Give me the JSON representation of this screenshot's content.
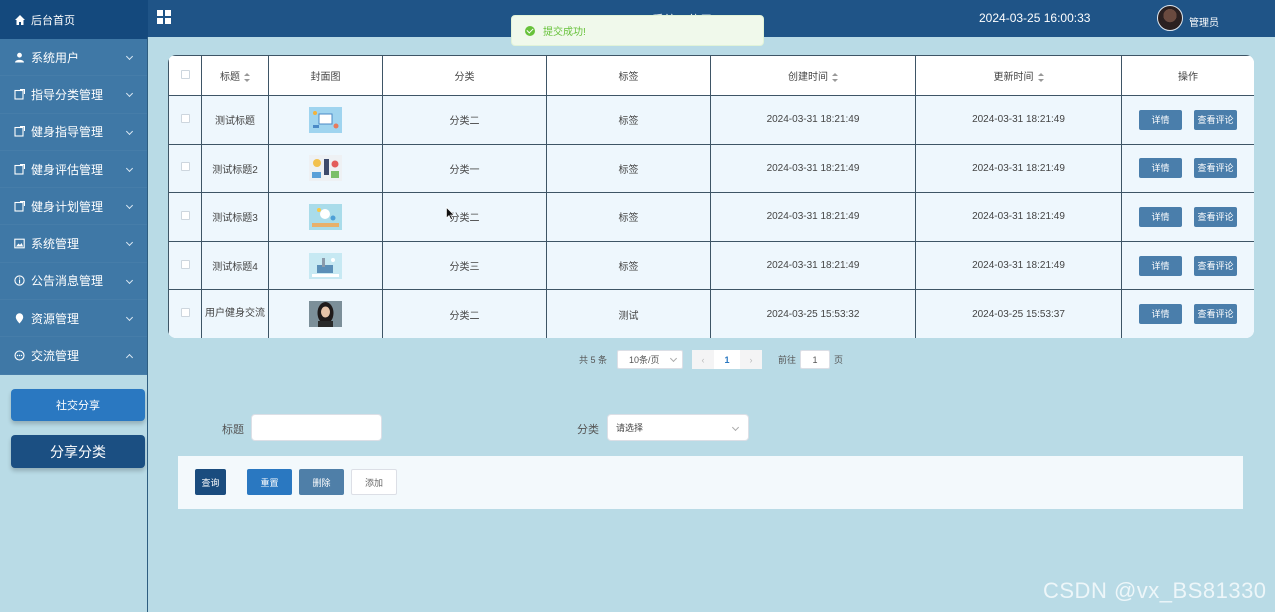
{
  "topbar": {
    "home_label": "后台首页",
    "system_title": "…系统…使用",
    "datetime": "2024-03-25 16:00:33",
    "admin_name": "管理员"
  },
  "toast": {
    "message": "提交成功!"
  },
  "sidebar": {
    "items": [
      {
        "label": "系统用户",
        "icon": "user-icon"
      },
      {
        "label": "指导分类管理",
        "icon": "doc-icon"
      },
      {
        "label": "健身指导管理",
        "icon": "doc-icon"
      },
      {
        "label": "健身评估管理",
        "icon": "doc-icon"
      },
      {
        "label": "健身计划管理",
        "icon": "doc-icon"
      },
      {
        "label": "系统管理",
        "icon": "image-icon"
      },
      {
        "label": "公告消息管理",
        "icon": "info-icon"
      },
      {
        "label": "资源管理",
        "icon": "location-icon"
      },
      {
        "label": "交流管理",
        "icon": "chat-icon"
      }
    ],
    "sub_items": [
      "社交分享",
      "分享分类"
    ]
  },
  "table": {
    "headers": [
      "标题",
      "封面图",
      "分类",
      "标签",
      "创建时间",
      "更新时间",
      "操作"
    ],
    "rows": [
      {
        "title": "测试标题",
        "category": "分类二",
        "tag": "标签",
        "created": "2024-03-31 18:21:49",
        "updated": "2024-03-31 18:21:49"
      },
      {
        "title": "测试标题2",
        "category": "分类一",
        "tag": "标签",
        "created": "2024-03-31 18:21:49",
        "updated": "2024-03-31 18:21:49"
      },
      {
        "title": "测试标题3",
        "category": "分类二",
        "tag": "标签",
        "created": "2024-03-31 18:21:49",
        "updated": "2024-03-31 18:21:49"
      },
      {
        "title": "测试标题4",
        "category": "分类三",
        "tag": "标签",
        "created": "2024-03-31 18:21:49",
        "updated": "2024-03-31 18:21:49"
      },
      {
        "title": "用户健身交流",
        "category": "分类二",
        "tag": "测试",
        "created": "2024-03-25 15:53:32",
        "updated": "2024-03-25 15:53:37"
      }
    ],
    "detail_label": "详情",
    "comment_label": "查看评论"
  },
  "pagination": {
    "total_text": "共 5 条",
    "page_size": "10条/页",
    "current_page": "1",
    "goto_label": "前往",
    "goto_value": "1",
    "page_unit": "页"
  },
  "search": {
    "title_label": "标题",
    "title_value": "",
    "category_label": "分类",
    "category_placeholder": "请选择"
  },
  "actions": {
    "query": "查询",
    "reset": "重置",
    "delete": "删除",
    "add": "添加"
  },
  "watermark": "CSDN @vx_BS81330",
  "colors": {
    "topbar": "#1f5487",
    "sidebar_menu": "#3f78a6",
    "page_bg": "#b9dbe6",
    "primary_button": "#2a78c1",
    "success": "#67c23a"
  }
}
